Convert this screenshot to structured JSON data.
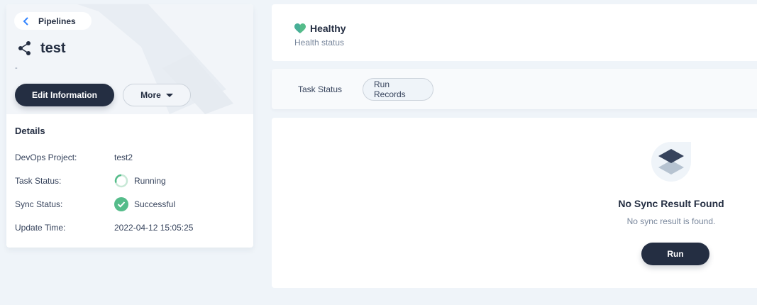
{
  "header": {
    "back_label": "Pipelines",
    "title": "test",
    "description": "-",
    "edit_label": "Edit Information",
    "more_label": "More"
  },
  "details": {
    "title": "Details",
    "rows": [
      {
        "key": "DevOps Project:",
        "value": "test2"
      },
      {
        "key": "Task Status:",
        "value": "Running",
        "icon": "running-spinner-icon"
      },
      {
        "key": "Sync Status:",
        "value": "Successful",
        "icon": "success-check-icon"
      },
      {
        "key": "Update Time:",
        "value": "2022-04-12 15:05:25"
      }
    ]
  },
  "health": {
    "status": "Healthy",
    "label": "Health status",
    "icon": "heart-icon",
    "color": "#55bc8a"
  },
  "tabs": [
    {
      "label": "Task Status",
      "active": false
    },
    {
      "label": "Run Records",
      "active": true
    }
  ],
  "empty_state": {
    "title": "No Sync Result Found",
    "message": "No sync result is found.",
    "run_label": "Run",
    "icon": "layers-icon"
  },
  "colors": {
    "primary_dark": "#242e42",
    "success": "#55bc8a",
    "background": "#eff4f9"
  }
}
